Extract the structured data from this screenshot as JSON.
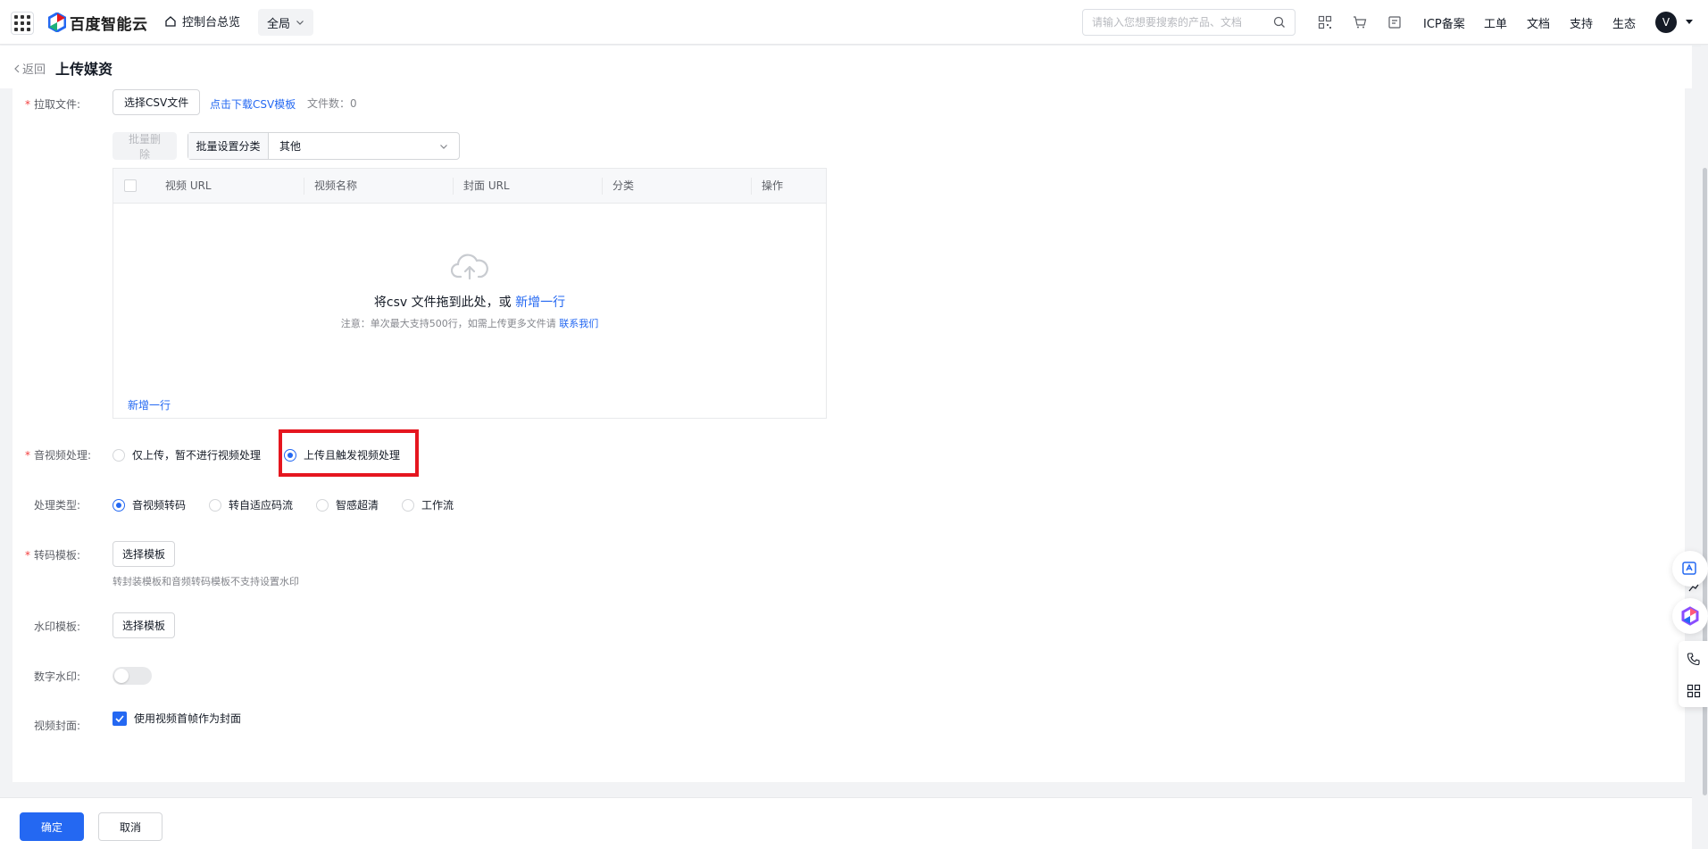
{
  "header": {
    "brand": "百度智能云",
    "console_home": "控制台总览",
    "scope": "全局",
    "search_placeholder": "请输入您想要搜索的产品、文档",
    "links": [
      "ICP备案",
      "工单",
      "文档",
      "支持",
      "生态"
    ],
    "avatar_letter": "V"
  },
  "page": {
    "back_label": "返回",
    "title": "上传媒资"
  },
  "form": {
    "pull_files": {
      "label": "拉取文件:",
      "select_csv": "选择CSV文件",
      "download_template": "点击下载CSV模板",
      "file_count": "文件数：0"
    },
    "batch_delete": "批量删除",
    "batch_category_label": "批量设置分类",
    "batch_category_value": "其他",
    "table": {
      "columns": [
        "视频 URL",
        "视频名称",
        "封面 URL",
        "分类",
        "操作"
      ],
      "empty_text": "将csv 文件拖到此处，或",
      "empty_link": "新增一行",
      "note_text": "注意：单次最大支持500行，如需上传更多文件请",
      "note_link": "联系我们",
      "add_row": "新增一行"
    },
    "av_processing": {
      "label": "音视频处理:",
      "options": [
        "仅上传，暂不进行视频处理",
        "上传且触发视频处理"
      ],
      "selected": "上传且触发视频处理"
    },
    "process_type": {
      "label": "处理类型:",
      "options": [
        "音视频转码",
        "转自适应码流",
        "智感超清",
        "工作流"
      ],
      "selected": "音视频转码"
    },
    "transcode_template": {
      "label": "转码模板:",
      "button": "选择模板",
      "hint": "转封装模板和音频转码模板不支持设置水印"
    },
    "watermark_template": {
      "label": "水印模板:",
      "button": "选择模板"
    },
    "digital_watermark": {
      "label": "数字水印:",
      "enabled": false
    },
    "video_cover": {
      "label": "视频封面:",
      "checkbox_label": "使用视频首帧作为封面",
      "checked": true
    }
  },
  "footer": {
    "confirm": "确定",
    "cancel": "取消"
  },
  "colors": {
    "primary": "#2468f2",
    "required": "#f33e3e",
    "highlight": "#e5161f"
  }
}
